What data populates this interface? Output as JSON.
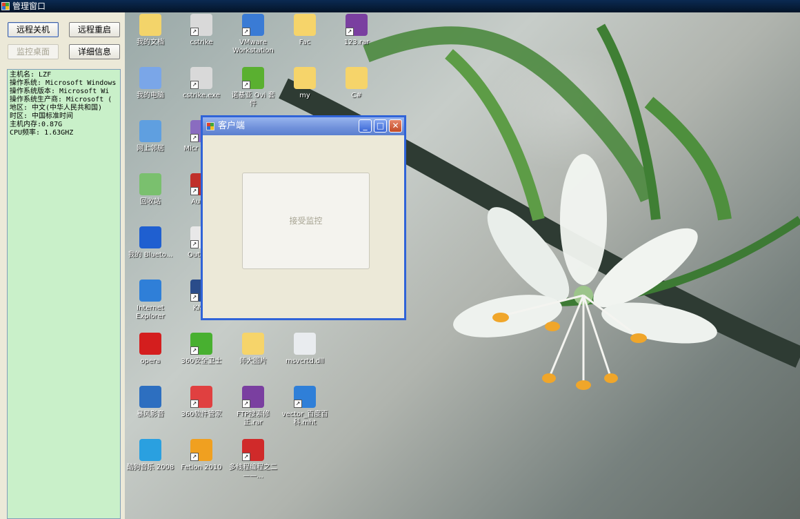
{
  "window": {
    "title": "管理窗口"
  },
  "buttons": {
    "remote_shutdown": "远程关机",
    "remote_restart": "远程重启",
    "monitor_desktop": "监控桌面",
    "details": "详细信息"
  },
  "info_lines": [
    "主机名: LZF",
    "操作系统: Microsoft Windows",
    "操作系统版本: Microsoft Wi",
    "操作系统生产商: Microsoft (",
    "地区: 中文(中华人民共和国)",
    "时区: 中国标准时间",
    "主机内存:0.87G",
    "CPU频率: 1.63GHZ"
  ],
  "desktop_icons": [
    {
      "label": "我的文档",
      "icon": "my-documents-icon",
      "color": "#f3d46a"
    },
    {
      "label": "cstrike",
      "icon": "cstrike-icon",
      "color": "#d9d9d9"
    },
    {
      "label": "VMware Workstation",
      "icon": "vmware-icon",
      "color": "#3a7bd5"
    },
    {
      "label": "Fac",
      "icon": "folder-icon",
      "color": "#f6d46a"
    },
    {
      "label": "123.rar",
      "icon": "rar-icon",
      "color": "#7a3fa0"
    },
    {
      "label": "我的电脑",
      "icon": "my-computer-icon",
      "color": "#7aa6e8"
    },
    {
      "label": "cstrike.exe",
      "icon": "cstrike-icon",
      "color": "#d9d9d9"
    },
    {
      "label": "诺基亚 Ovi 套件",
      "icon": "ovi-icon",
      "color": "#5ab030"
    },
    {
      "label": "my",
      "icon": "folder-icon",
      "color": "#f6d46a"
    },
    {
      "label": "C#",
      "icon": "folder-icon",
      "color": "#f6d46a"
    },
    {
      "label": "网上邻居",
      "icon": "network-icon",
      "color": "#5f9fe0"
    },
    {
      "label": "Micr Visua",
      "icon": "visual-studio-icon",
      "color": "#8a6cc0"
    },
    {
      "label": "回收站",
      "icon": "recycle-bin-icon",
      "color": "#7ac06e"
    },
    {
      "label": "Autho",
      "icon": "author-icon",
      "color": "#c0302a"
    },
    {
      "label": "我的 Blueto...",
      "icon": "bluetooth-icon",
      "color": "#1f5fd0"
    },
    {
      "label": "Out Exp",
      "icon": "outlook-express-icon",
      "color": "#e8e8e8"
    },
    {
      "label": "Internet Explorer",
      "icon": "internet-explorer-icon",
      "color": "#2f7fd8"
    },
    {
      "label": "KMPl",
      "icon": "kmplayer-icon",
      "color": "#2a4c8a"
    },
    {
      "label": "opera",
      "icon": "opera-icon",
      "color": "#d41e1e"
    },
    {
      "label": "360安全卫士",
      "icon": "360-security-icon",
      "color": "#48b030"
    },
    {
      "label": "师大图片",
      "icon": "folder-icon",
      "color": "#f6d46a"
    },
    {
      "label": "msvcrtd.dll",
      "icon": "dll-icon",
      "color": "#e9ecef"
    },
    {
      "label": "暴风影音",
      "icon": "baofeng-icon",
      "color": "#2d6fc0"
    },
    {
      "label": "360软件管家",
      "icon": "360-software-icon",
      "color": "#e04040"
    },
    {
      "label": "FTP搜索修正.rar",
      "icon": "rar-icon",
      "color": "#7a3fa0"
    },
    {
      "label": "vector_百度百科.mht",
      "icon": "internet-explorer-icon",
      "color": "#2f7fd8"
    },
    {
      "label": "酷狗音乐 2008",
      "icon": "kugou-icon",
      "color": "#2aa0e0"
    },
    {
      "label": "Fetion 2010",
      "icon": "fetion-icon",
      "color": "#f0a020"
    },
    {
      "label": "多线程编程之二——...",
      "icon": "pdf-icon",
      "color": "#d02a2a"
    }
  ],
  "client_dialog": {
    "title": "客户端",
    "accept_button": "接受监控"
  }
}
